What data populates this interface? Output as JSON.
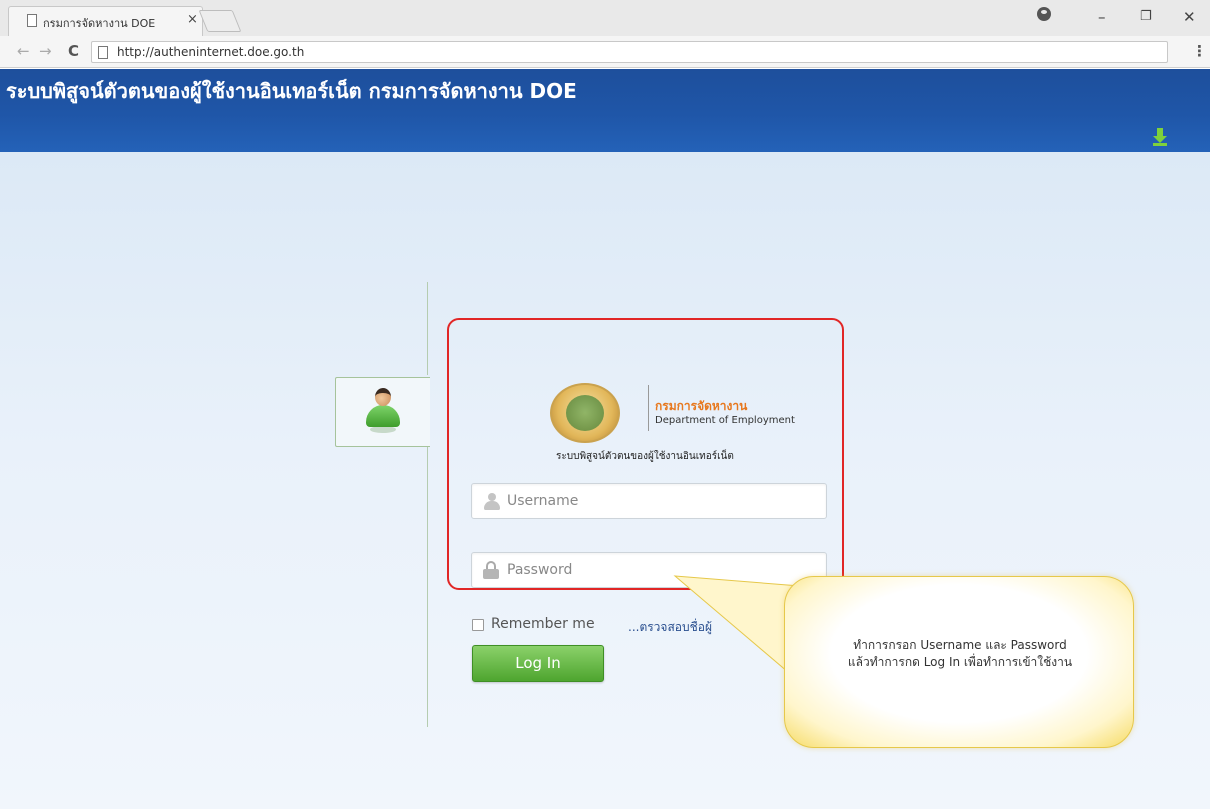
{
  "browser": {
    "tab_title": "กรมการจัดหางาน DOE",
    "tab_close": "×",
    "url": "http://autheninternet.doe.go.th",
    "back": "←",
    "forward": "→",
    "reload": "C",
    "menu": "⋮",
    "minimize": "–",
    "restore": "❐",
    "close": "✕"
  },
  "header": {
    "title": "ระบบพิสูจน์ตัวตนของผู้ใช้งานอินเทอร์เน็ต กรมการจัดหางาน DOE"
  },
  "login": {
    "org_name_th": "กรมการจัดหางาน",
    "org_name_en": "Department of Employment",
    "system_subtitle": "ระบบพิสูจน์ตัวตนของผู้ใช้งานอินเทอร์เน็ต",
    "username_placeholder": "Username",
    "password_placeholder": "Password",
    "remember_label": "Remember me",
    "verify_link": "...ตรวจสอบชื่อผู้",
    "login_button": "Log In"
  },
  "callout": {
    "line1": "ทำการกรอก Username และ Password",
    "line2": "แล้วทำการกด Log In เพื่อทำการเข้าใช้งาน"
  },
  "colors": {
    "header_blue": "#1f56a8",
    "login_green": "#4ea52f",
    "highlight_red": "#e12626",
    "org_orange": "#e7781e"
  }
}
